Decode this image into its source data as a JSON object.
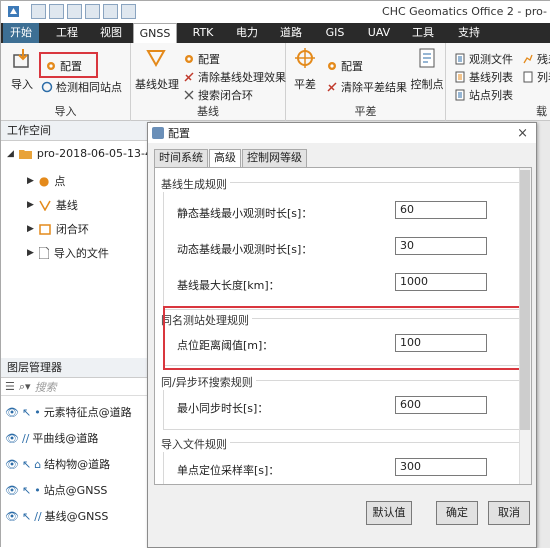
{
  "app": {
    "title": "CHC Geomatics Office 2 - pro-"
  },
  "menu": {
    "items": [
      "开始",
      "工程",
      "视图",
      "GNSS",
      "RTK",
      "电力",
      "道路",
      "GIS",
      "UAV",
      "工具",
      "支持"
    ],
    "active": "GNSS"
  },
  "ribbon": {
    "import_group": {
      "label": "导入",
      "import_button": "导入",
      "config_button": "配置",
      "check_same_station": "检测相同站点"
    },
    "baseline_group": {
      "label": "基线",
      "process_button": "基线处理",
      "config_button": "配置",
      "clear_results": "清除基线处理效果",
      "search_loop": "搜索闭合环"
    },
    "adjust_group": {
      "label": "平差",
      "adjust_button": "平差",
      "config_button": "配置",
      "clear_results": "清除平差结果",
      "control_points": "控制点"
    },
    "reports_group": {
      "label": "载",
      "obs_file": "观测文件",
      "baseline_list": "基线列表",
      "station_list": "站点列表",
      "extra1": "残差",
      "extra2": "列表"
    }
  },
  "workspace": {
    "title": "工作空间",
    "project": "pro-2018-06-05-13-4",
    "items": [
      "点",
      "基线",
      "闭合环",
      "导入的文件"
    ]
  },
  "layers": {
    "title": "图层管理器",
    "search_placeholder": "搜索",
    "items": [
      "元素特征点@道路",
      "平曲线@道路",
      "结构物@道路",
      "站点@GNSS",
      "基线@GNSS"
    ]
  },
  "dialog": {
    "title": "配置",
    "tabs": [
      "时间系统",
      "高级",
      "控制网等级"
    ],
    "active_tab": "高级",
    "sections": [
      {
        "title": "基线生成规则",
        "fields": [
          {
            "label": "静态基线最小观测时长[s]：",
            "value": "60"
          },
          {
            "label": "动态基线最小观测时长[s]：",
            "value": "30"
          },
          {
            "label": "基线最大长度[km]：",
            "value": "1000"
          }
        ]
      },
      {
        "title": "同名测站处理规则",
        "fields": [
          {
            "label": "点位距离阈值[m]：",
            "value": "100"
          }
        ]
      },
      {
        "title": "同/异步环搜索规则",
        "fields": [
          {
            "label": "最小同步时长[s]：",
            "value": "600"
          }
        ]
      },
      {
        "title": "导入文件规则",
        "fields": [
          {
            "label": "单点定位采样率[s]：",
            "value": "300"
          }
        ]
      }
    ],
    "buttons": {
      "default": "默认值",
      "ok": "确定",
      "cancel": "取消"
    }
  },
  "colors": {
    "highlight": "#d9363e",
    "menubar": "#2a2a2a",
    "accent": "#2d6da8"
  }
}
